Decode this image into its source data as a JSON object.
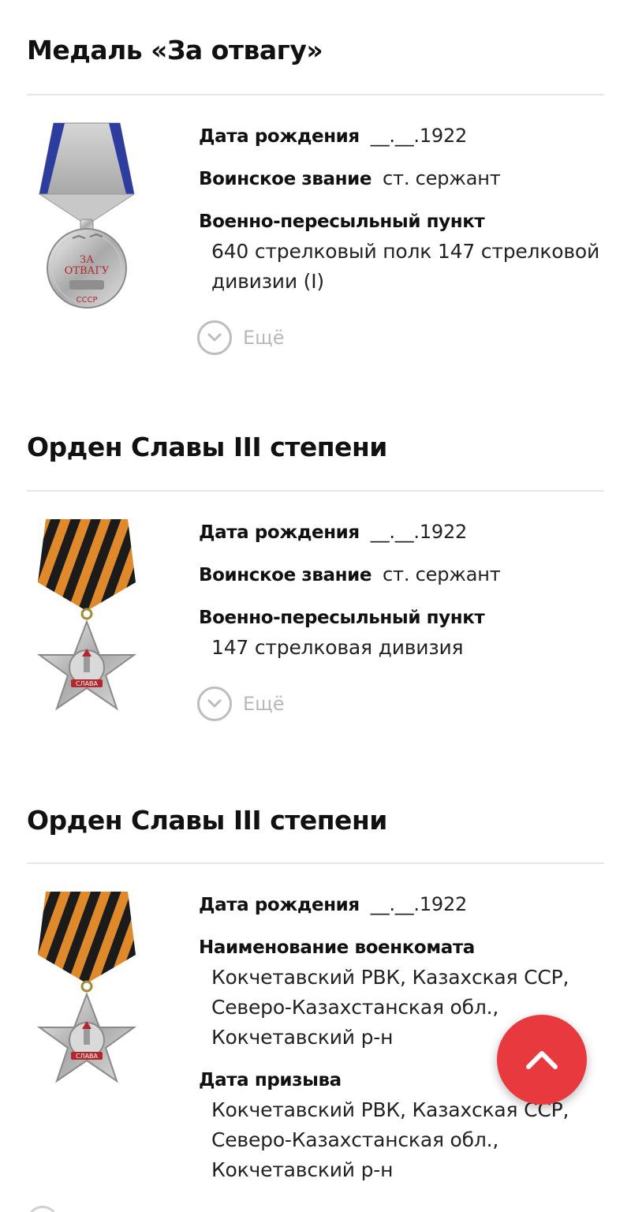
{
  "awards": [
    {
      "title": "Медаль «За отвагу»",
      "image_icon": "medal-for-courage-icon",
      "birth_date": {
        "label": "Дата рождения",
        "value": "__.__.1922"
      },
      "rank": {
        "label": "Воинское звание",
        "value": "ст. сержант"
      },
      "point": {
        "label": "Военно-пересыльный пункт",
        "value": "640 стрелковый полк 147 стрелковой\nдивизии (I)"
      },
      "more_label": "Ещё"
    },
    {
      "title": "Орден Славы III степени",
      "image_icon": "order-of-glory-icon",
      "birth_date": {
        "label": "Дата рождения",
        "value": "__.__.1922"
      },
      "rank": {
        "label": "Воинское звание",
        "value": "ст. сержант"
      },
      "point": {
        "label": "Военно-пересыльный пункт",
        "value": "147 стрелковая дивизия"
      },
      "more_label": "Ещё"
    },
    {
      "title": "Орден Славы III степени",
      "image_icon": "order-of-glory-icon",
      "birth_date": {
        "label": "Дата рождения",
        "value": "__.__.1922"
      },
      "enlistment_office": {
        "label": "Наименование военкомата",
        "value": "Кокчетавский РВК, Казахская ССР,\nСеверо-Казахстанская обл.,\nКокчетавский р-н"
      },
      "draft_date": {
        "label": "Дата призыва",
        "value": "Кокчетавский РВК, Казахская ССР,\nСеверо-Казахстанская обл.,\nКокчетавский р-н"
      }
    }
  ],
  "scroll_top": {
    "icon": "chevron-up-icon",
    "color": "#e8393f"
  },
  "colors": {
    "accent": "#e8393f",
    "divider": "#e6e6e6",
    "muted": "#b8b8b8"
  },
  "medal_text": {
    "courage_top": "ЗА",
    "courage_bottom": "ОТВАГУ",
    "ussr": "СССР",
    "glory": "СЛАВА"
  }
}
